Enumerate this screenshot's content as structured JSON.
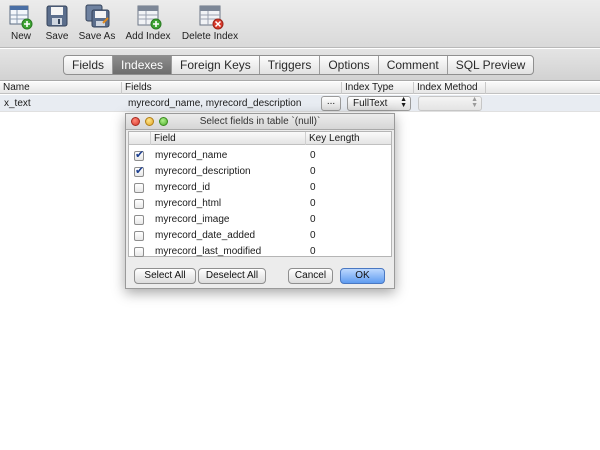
{
  "toolbar": {
    "new": "New",
    "save": "Save",
    "save_as": "Save As",
    "add_index": "Add Index",
    "delete_index": "Delete Index"
  },
  "tabs": [
    "Fields",
    "Indexes",
    "Foreign Keys",
    "Triggers",
    "Options",
    "Comment",
    "SQL Preview"
  ],
  "active_tab": "Indexes",
  "table": {
    "columns": {
      "name": "Name",
      "fields": "Fields",
      "index_type": "Index Type",
      "index_method": "Index Method"
    },
    "rows": [
      {
        "name": "x_text",
        "fields": "myrecord_name, myrecord_description",
        "index_type": "FullText",
        "index_method": ""
      }
    ],
    "dots_label": "..."
  },
  "dialog": {
    "title": "Select fields in table `(null)`",
    "columns": {
      "field": "Field",
      "key_length": "Key Length"
    },
    "rows": [
      {
        "field": "myrecord_name",
        "key_length": "0",
        "checked": true
      },
      {
        "field": "myrecord_description",
        "key_length": "0",
        "checked": true
      },
      {
        "field": "myrecord_id",
        "key_length": "0",
        "checked": false
      },
      {
        "field": "myrecord_html",
        "key_length": "0",
        "checked": false
      },
      {
        "field": "myrecord_image",
        "key_length": "0",
        "checked": false
      },
      {
        "field": "myrecord_date_added",
        "key_length": "0",
        "checked": false
      },
      {
        "field": "myrecord_last_modified",
        "key_length": "0",
        "checked": false
      }
    ],
    "buttons": {
      "select_all": "Select All",
      "deselect_all": "Deselect All",
      "cancel": "Cancel",
      "ok": "OK"
    }
  },
  "colors": {
    "active_tab": "#7a7a7a",
    "selected_row": "#e8ecf2",
    "ok_button": "#5f9cf0",
    "checkmark": "#1c3f8f"
  }
}
